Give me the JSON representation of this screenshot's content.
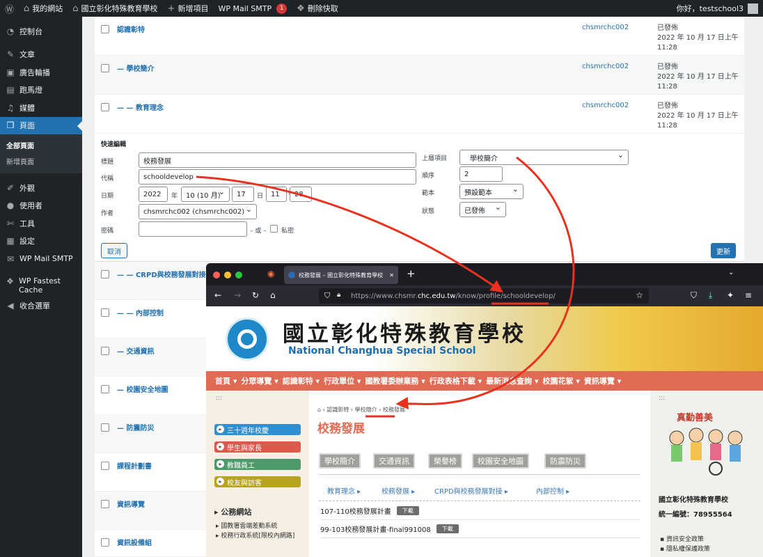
{
  "adminbar": {
    "my_sites": "我的網站",
    "site_name": "國立彰化特殊教育學校",
    "new_item": "新增項目",
    "smtp": "WP Mail SMTP",
    "smtp_badge": "1",
    "clear_cache": "刪除快取",
    "greeting": "你好，testschool3"
  },
  "sidebar": {
    "items": [
      {
        "label": "控制台",
        "icon": "dashboard-icon"
      },
      {
        "label": "文章",
        "icon": "pin-icon"
      },
      {
        "label": "廣告輪播",
        "icon": "ad-icon"
      },
      {
        "label": "跑馬燈",
        "icon": "marquee-icon"
      },
      {
        "label": "媒體",
        "icon": "media-icon"
      },
      {
        "label": "頁面",
        "icon": "page-icon"
      },
      {
        "label": "外觀",
        "icon": "brush-icon"
      },
      {
        "label": "使用者",
        "icon": "user-icon"
      },
      {
        "label": "工具",
        "icon": "wrench-icon"
      },
      {
        "label": "設定",
        "icon": "settings-icon"
      },
      {
        "label": "WP Mail SMTP",
        "icon": "mail-icon"
      },
      {
        "label": "WP Fastest Cache",
        "icon": "cheetah-icon"
      },
      {
        "label": "收合選單",
        "icon": "collapse-icon"
      }
    ],
    "submenu": [
      "全部頁面",
      "新增頁面"
    ]
  },
  "rows_top": [
    {
      "title": "認識彰特",
      "author": "chsmrchc002",
      "status": "已發佈",
      "date": "2022 年 10 月 17 日上午",
      "time": "11:28"
    },
    {
      "title": "— 學校簡介",
      "author": "chsmrchc002",
      "status": "已發佈",
      "date": "2022 年 10 月 17 日上午",
      "time": "11:28"
    },
    {
      "title": "— — 教育理念",
      "author": "chsmrchc002",
      "status": "已發佈",
      "date": "2022 年 10 月 17 日上午",
      "time": "11:28"
    }
  ],
  "quickedit": {
    "heading": "快速編輯",
    "label_title": "標題",
    "value_title": "校務發展",
    "label_slug": "代稱",
    "value_slug": "schooldevelop",
    "label_date": "日期",
    "year": "2022",
    "year_unit": "年",
    "month": "10 (10 月)",
    "day": "17",
    "day_unit": "日",
    "hour": "11",
    "minute": "28",
    "label_author": "作者",
    "author": "chsmrchc002 (chsmrchc002)",
    "label_password": "密碼",
    "or_text": "– 或 –",
    "private": "私密",
    "label_parent": "上層項目",
    "parent": "學校簡介",
    "label_order": "順序",
    "order": "2",
    "label_template": "範本",
    "template": "預設範本",
    "label_status": "狀態",
    "status": "已發佈",
    "cancel": "取消",
    "update": "更新"
  },
  "rows_bottom": [
    {
      "title": "— — CRPD與校務發展對接"
    },
    {
      "title": "— — 內部控制"
    },
    {
      "title": "— 交通資訊"
    },
    {
      "title": "— 校園安全地圖"
    },
    {
      "title": "— 防震防災"
    },
    {
      "title": "課程計劃書"
    },
    {
      "title": "資訊導覽"
    },
    {
      "title": "資訊設備組"
    }
  ],
  "browser": {
    "tab_title": "校務發展 – 國立彰化特殊教育學校",
    "url_prefix": "https://www.chsmr.",
    "url_domain": "chc.edu.tw",
    "url_path": "/know/profile/",
    "url_slug": "schooldevelop/"
  },
  "site": {
    "title_cn": "國立彰化特殊教育學校",
    "title_en": "National Changhua Special School",
    "nav": [
      "首頁 ▾",
      "分眾導覽 ▾",
      "認識彰特 ▾",
      "行政單位 ▾",
      "國教署委辦業務 ▾",
      "行政表格下載 ▾",
      "最新消息查詢 ▾",
      "校園花絮 ▾",
      "資訊導覽 ▾"
    ],
    "left_dots": ":::",
    "pills": [
      "三十週年校慶",
      "學生與家長",
      "教職員工",
      "校友與訪客"
    ],
    "pill_colors": [
      "#2f8fd0",
      "#e0574c",
      "#4e9a6b",
      "#b8a41c"
    ],
    "gov_heading": "公務網站",
    "gov_links": [
      "國教署雲端差勤系統",
      "校務行政系統[限校內網路]"
    ],
    "breadcrumb": [
      "認識彰特",
      "學校簡介",
      "校務發展"
    ],
    "page_title": "校務發展",
    "categories": [
      "學校簡介",
      "交通資訊",
      "榮譽榜",
      "校園安全地圖",
      "防震防災"
    ],
    "sublinks": [
      "教育理念",
      "校務發展",
      "CRPD與校務發展對接",
      "內部控制"
    ],
    "downloads": [
      {
        "name": "107-110校務發展計畫",
        "btn": "下載"
      },
      {
        "name": "99-103校務發展計畫-final991008",
        "btn": "下載"
      }
    ],
    "right_dots": ":::",
    "school_name": "國立彰化特殊教育學校",
    "unified_no": "統一編號：78955564",
    "footer_links": [
      "資訊安全政策",
      "隱私權保護政策"
    ],
    "mascot_text": "真勤善美"
  },
  "colors": {
    "wp_blue": "#2271b1",
    "admin_dark": "#1d2327",
    "nav_red": "#e06b55",
    "arrow_red": "#e8321e"
  }
}
